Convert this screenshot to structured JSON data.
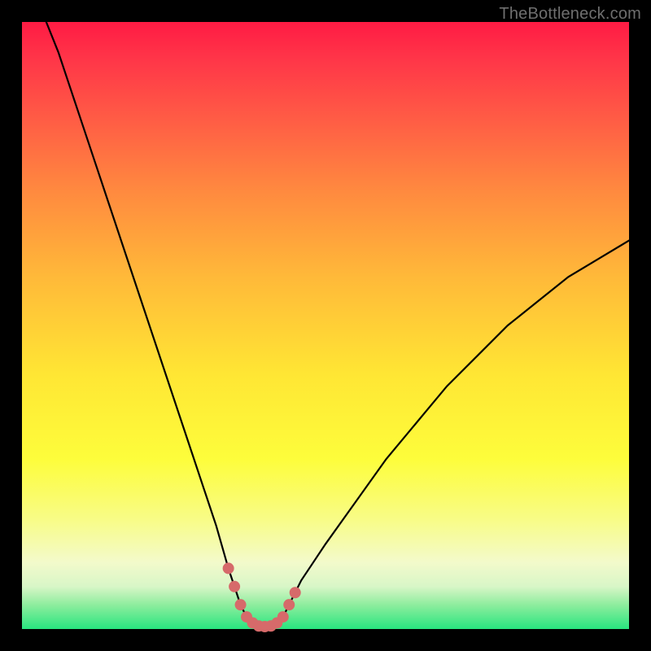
{
  "watermark": "TheBottleneck.com",
  "colors": {
    "background": "#000000",
    "curve": "#000000",
    "markers": "#d66a6a",
    "watermark_text": "#6f6f6f"
  },
  "chart_data": {
    "type": "line",
    "title": "",
    "xlabel": "",
    "ylabel": "",
    "xlim": [
      0,
      100
    ],
    "ylim": [
      0,
      100
    ],
    "grid": false,
    "legend": false,
    "series": [
      {
        "name": "bottleneck-curve",
        "x": [
          4,
          6,
          8,
          10,
          12,
          14,
          16,
          18,
          20,
          22,
          24,
          26,
          28,
          30,
          32,
          34,
          35,
          36,
          37,
          38,
          39,
          40,
          41,
          42,
          43,
          44,
          46,
          50,
          55,
          60,
          65,
          70,
          75,
          80,
          85,
          90,
          95,
          100
        ],
        "y": [
          100,
          95,
          89,
          83,
          77,
          71,
          65,
          59,
          53,
          47,
          41,
          35,
          29,
          23,
          17,
          10,
          7,
          4,
          2,
          1,
          0.5,
          0.4,
          0.5,
          1,
          2,
          4,
          8,
          14,
          21,
          28,
          34,
          40,
          45,
          50,
          54,
          58,
          61,
          64
        ]
      }
    ],
    "markers": {
      "name": "bottom-markers",
      "points_xy": [
        [
          34,
          10
        ],
        [
          35,
          7
        ],
        [
          36,
          4
        ],
        [
          37,
          2
        ],
        [
          38,
          1
        ],
        [
          39,
          0.5
        ],
        [
          40,
          0.4
        ],
        [
          41,
          0.5
        ],
        [
          42,
          1
        ],
        [
          43,
          2
        ],
        [
          44,
          4
        ],
        [
          45,
          6
        ]
      ]
    }
  }
}
